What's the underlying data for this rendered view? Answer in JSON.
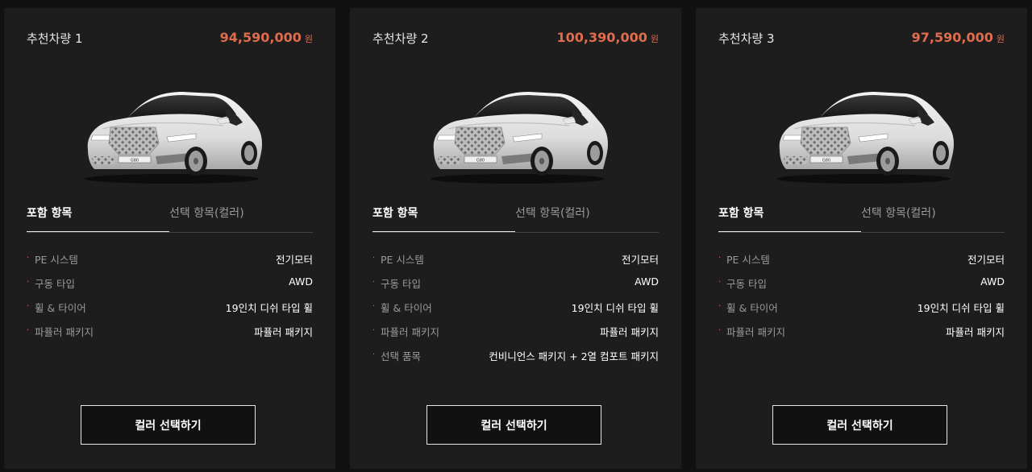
{
  "cards": [
    {
      "title": "추천차량 1",
      "price": "94,590,000",
      "price_unit": "원",
      "image": "white-genesis-g80-sedan",
      "tabs": [
        "포함 항목",
        "선택 항목(컬러)"
      ],
      "specs": [
        {
          "label": "PE 시스템",
          "value": "전기모터"
        },
        {
          "label": "구동 타입",
          "value": "AWD"
        },
        {
          "label": "휠 & 타이어",
          "value": "19인치 디쉬 타입 휠"
        },
        {
          "label": "파퓰러 패키지",
          "value": "파퓰러 패키지"
        }
      ],
      "cta": "컬러 선택하기"
    },
    {
      "title": "추천차량 2",
      "price": "100,390,000",
      "price_unit": "원",
      "image": "white-genesis-g80-sedan",
      "tabs": [
        "포함 항목",
        "선택 항목(컬러)"
      ],
      "specs": [
        {
          "label": "PE 시스템",
          "value": "전기모터"
        },
        {
          "label": "구동 타입",
          "value": "AWD"
        },
        {
          "label": "휠 & 타이어",
          "value": "19인치 디쉬 타입 휠"
        },
        {
          "label": "파퓰러 패키지",
          "value": "파퓰러 패키지"
        },
        {
          "label": "선택 품목",
          "value": "컨비니언스 패키지 + 2열 컴포트 패키지"
        }
      ],
      "cta": "컬러 선택하기"
    },
    {
      "title": "추천차량 3",
      "price": "97,590,000",
      "price_unit": "원",
      "image": "white-genesis-g80-sedan",
      "tabs": [
        "포함 항목",
        "선택 항목(컬러)"
      ],
      "specs": [
        {
          "label": "PE 시스템",
          "value": "전기모터"
        },
        {
          "label": "구동 타입",
          "value": "AWD"
        },
        {
          "label": "휠 & 타이어",
          "value": "19인치 디쉬 타입 휠"
        },
        {
          "label": "파퓰러 패키지",
          "value": "파퓰러 패키지"
        }
      ],
      "cta": "컬러 선택하기"
    }
  ],
  "colors": {
    "page_bg": "#111111",
    "card_bg": "#1d1d1d",
    "price": "#e06c4c",
    "bullet": "#e06c4c",
    "muted_text": "#9a9a9a",
    "text": "#ffffff"
  }
}
